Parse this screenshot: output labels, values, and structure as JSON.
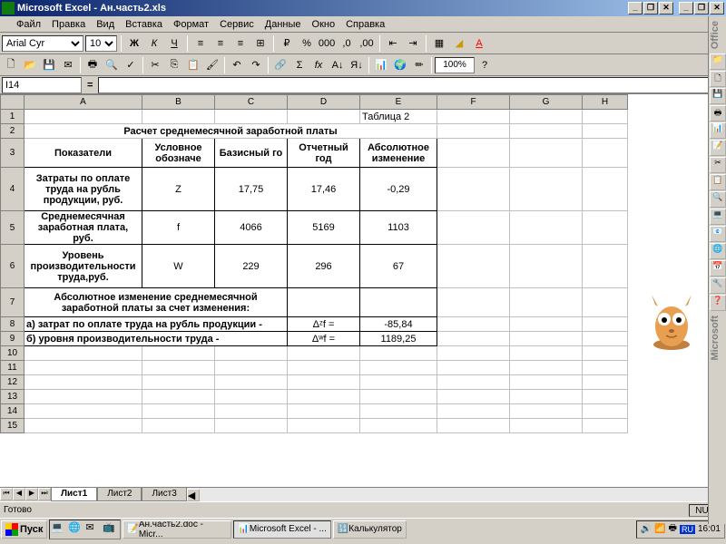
{
  "app": {
    "name": "Microsoft Excel",
    "file": "Ан.часть2.xls"
  },
  "window_buttons": {
    "min": "_",
    "restore": "❐",
    "close": "✕"
  },
  "menu": [
    "Файл",
    "Правка",
    "Вид",
    "Вставка",
    "Формат",
    "Сервис",
    "Данные",
    "Окно",
    "Справка"
  ],
  "format_toolbar": {
    "font_name": "Arial Cyr",
    "font_size": "10",
    "zoom": "100%"
  },
  "name_box": "I14",
  "columns": [
    "A",
    "B",
    "C",
    "D",
    "E",
    "F",
    "G",
    "H"
  ],
  "rows": [
    1,
    2,
    3,
    4,
    5,
    6,
    7,
    8,
    9,
    10,
    11,
    12,
    13,
    14,
    15
  ],
  "table_label": "Таблица 2",
  "title": "Расчет среднемесячной заработной платы",
  "headers": {
    "c1": "Показатели",
    "c2": "Условное обозначе",
    "c3": "Базисный го",
    "c4": "Отчетный год",
    "c5": "Абсолютное изменение"
  },
  "data": [
    {
      "label": "Затраты по оплате труда на рубль продукции, руб.",
      "sym": "Z",
      "base": "17,75",
      "rep": "17,46",
      "abs": "-0,29"
    },
    {
      "label": "Среднемесячная заработная плата, руб.",
      "sym": "f",
      "base": "4066",
      "rep": "5169",
      "abs": "1103"
    },
    {
      "label": "Уровень производительности труда,руб.",
      "sym": "W",
      "base": "229",
      "rep": "296",
      "abs": "67"
    }
  ],
  "section": "Абсолютное изменение среднемесячной заработной платы за счет изменения:",
  "factors": [
    {
      "label": "а) затрат по оплате труда на рубль продукции -",
      "sym": "Δᶻf =",
      "val": "-85,84"
    },
    {
      "label": "б) уровня производительности труда -",
      "sym": "Δʷf =",
      "val": "1189,25"
    }
  ],
  "tabs": [
    "Лист1",
    "Лист2",
    "Лист3"
  ],
  "status": {
    "ready": "Готово",
    "num": "NUM"
  },
  "taskbar": {
    "start": "Пуск",
    "tasks": [
      "Ан.часть2.doc - Micr...",
      "Microsoft Excel - ...",
      "Калькулятор"
    ],
    "lang": "RU",
    "time": "16:01"
  },
  "office_label": "Office",
  "ms_label": "Microsoft"
}
